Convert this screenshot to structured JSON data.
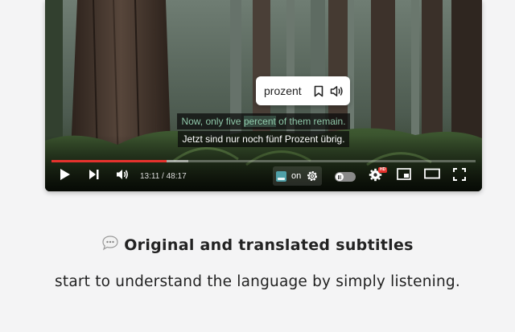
{
  "video": {
    "popup": {
      "word": "prozent"
    },
    "subtitles": {
      "original_before": "Now, only five ",
      "original_highlight": "percent",
      "original_after": " of them remain.",
      "translation": "Jetzt sind nur noch fünf Prozent übrig."
    },
    "progress": {
      "played_fraction": 0.272,
      "buffered_fraction": 0.05
    },
    "time_display": "13:11 / 48:17",
    "subtitle_toggle_label": "on",
    "quality_badge": "HD"
  },
  "feature": {
    "title": "Original and translated subtitles",
    "description": "start to understand the language by simply listening."
  },
  "colors": {
    "accent_red": "#e5322d",
    "subtitle_original": "#8fc7a9"
  }
}
